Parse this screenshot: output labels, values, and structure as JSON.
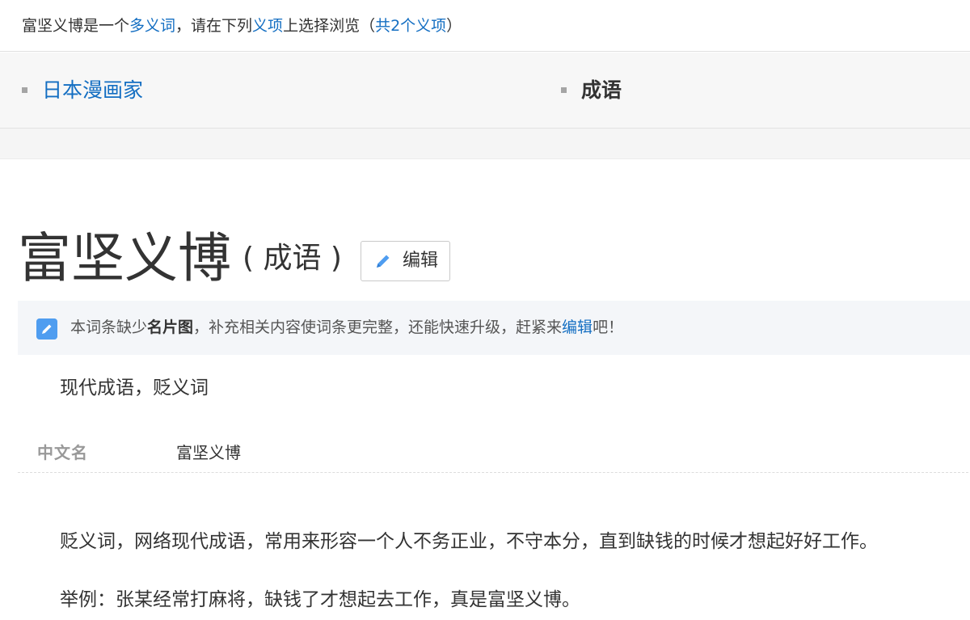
{
  "polysemy": {
    "lead": "富坚义博是一个",
    "term_link": "多义词",
    "mid": "，请在下列",
    "sense_link": "义项",
    "tail": "上选择浏览（",
    "count_link": "共2个义项",
    "close": "）"
  },
  "senses": [
    {
      "label": "日本漫画家",
      "active": false
    },
    {
      "label": "成语",
      "active": true
    }
  ],
  "lemma": {
    "title": "富坚义博",
    "subtitle": "( 成语 )",
    "edit_label": "编辑"
  },
  "notice": {
    "part1": "本词条缺少",
    "bold": "名片图",
    "part2": "，补充相关内容使词条更完整，还能快速升级，赶紧来",
    "edit_link": "编辑",
    "part3": "吧！"
  },
  "summary": "现代成语，贬义词",
  "basic_info": {
    "key": "中文名",
    "value": "富坚义博"
  },
  "paragraphs": [
    "贬义词，网络现代成语，常用来形容一个人不务正业，不守本分，直到缺钱的时候才想起好好工作。",
    "举例：张某经常打麻将，缺钱了才想起去工作，真是富坚义博。"
  ],
  "colors": {
    "link": "#136ec2",
    "notice_icon": "#4f9df0",
    "notice_bg": "#f4f6f9"
  }
}
